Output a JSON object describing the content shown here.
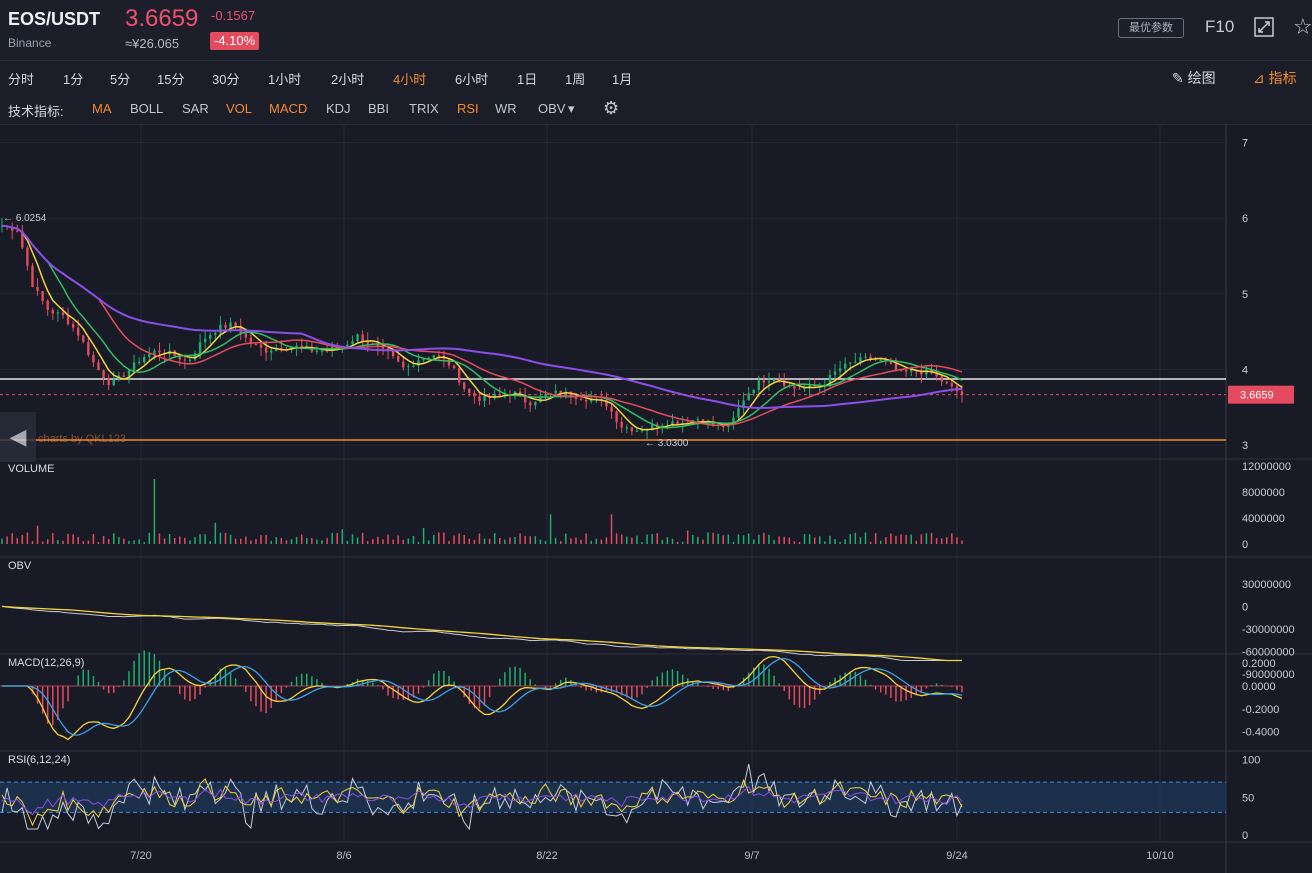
{
  "header": {
    "symbol": "EOS/USDT",
    "exchange": "Binance",
    "price": "3.6659",
    "change": "-0.1567",
    "cny": "≈¥26.065",
    "change_pct": "-4.10%",
    "param_btn": "最优参数",
    "f10": "F10",
    "icons": [
      "fullscreen-icon",
      "star-icon"
    ]
  },
  "toolbar": {
    "timeframes": [
      "分时",
      "1分",
      "5分",
      "15分",
      "30分",
      "1小时",
      "2小时",
      "4小时",
      "6小时",
      "1日",
      "1周",
      "1月"
    ],
    "active_timeframe": "4小时",
    "draw_label": "绘图",
    "indicator_label": "指标"
  },
  "indicators": {
    "label": "技术指标:",
    "items": [
      "MA",
      "BOLL",
      "SAR",
      "VOL",
      "MACD",
      "KDJ",
      "BBI",
      "TRIX",
      "RSI",
      "WR",
      "OBV"
    ],
    "active": [
      "MA",
      "VOL",
      "MACD",
      "RSI"
    ]
  },
  "colors": {
    "up": "#1fae6f",
    "down": "#e44b5f",
    "ma_fast": "#f5d33b",
    "ma_mid": "#2fbf64",
    "ma_slow": "#e44b5f",
    "ma_long": "#8a4fe8",
    "accent": "#f28b2e"
  },
  "chart_data": [
    {
      "type": "line",
      "panel": "price",
      "x": [
        "7/20",
        "8/6",
        "8/22",
        "9/7",
        "9/24",
        "10/10"
      ],
      "ylim": [
        3,
        7
      ],
      "y_ticks": [
        "7",
        "6",
        "5",
        "4",
        "3"
      ],
      "annotations": {
        "high": "← 6.0254",
        "low": "← 3.0300",
        "last_price": "3.6659",
        "watermark": "charts by QKL123"
      },
      "series": [
        {
          "values": [
            5.9,
            5.85,
            5.1,
            4.78,
            4.7,
            4.45,
            4.05,
            3.8,
            3.95,
            4.15,
            4.25,
            4.2,
            4.1,
            4.4,
            4.55,
            4.6,
            4.35,
            4.25,
            4.3,
            4.3,
            4.25,
            4.25,
            4.3,
            4.45,
            4.3,
            4.2,
            4.0,
            4.15,
            4.2,
            4.05,
            3.7,
            3.6,
            3.65,
            3.7,
            3.55,
            3.65,
            3.7,
            3.65,
            3.6,
            3.55,
            3.25,
            3.2,
            3.25,
            3.3,
            3.3,
            3.35,
            3.25,
            3.25,
            3.65,
            3.85,
            3.9,
            3.75,
            3.75,
            3.8,
            4.0,
            4.1,
            4.15,
            4.1,
            3.95,
            3.98,
            3.95,
            3.8,
            3.6659
          ]
        }
      ]
    },
    {
      "type": "bar",
      "panel": "volume",
      "title": "VOLUME",
      "y_ticks": [
        "12000000",
        "8000000",
        "4000000",
        "0"
      ],
      "ylim": [
        0,
        12000000
      ]
    },
    {
      "type": "line",
      "panel": "obv",
      "title": "OBV",
      "y_ticks": [
        "30000000",
        "0",
        "-30000000",
        "-60000000",
        "-90000000"
      ],
      "ylim": [
        -90000000,
        30000000
      ]
    },
    {
      "type": "line",
      "panel": "macd",
      "title": "MACD(12,26,9)",
      "y_ticks": [
        "0.2000",
        "0.0000",
        "-0.2000",
        "-0.4000"
      ],
      "ylim": [
        -0.4,
        0.2
      ]
    },
    {
      "type": "line",
      "panel": "rsi",
      "title": "RSI(6,12,24)",
      "y_ticks": [
        "100",
        "50",
        "0"
      ],
      "ylim": [
        0,
        100
      ]
    }
  ]
}
